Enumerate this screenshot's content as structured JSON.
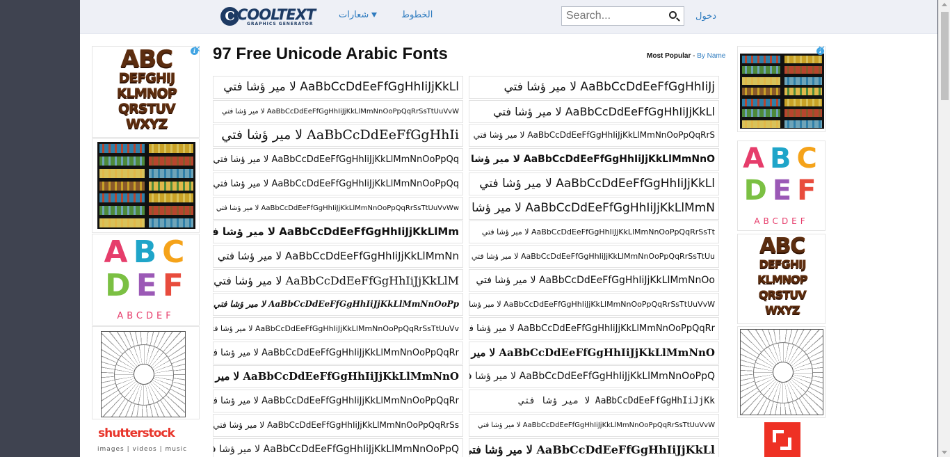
{
  "site": {
    "logo_text": "COOLTEXT",
    "logo_subtext": "GRAPHICS GENERATOR",
    "logo_mark": "C"
  },
  "nav": {
    "logos_label": "شعارات",
    "fonts_label": "الخطوط",
    "login_label": "دخول",
    "search_placeholder": "Search..."
  },
  "page": {
    "title": "97 Free Unicode Arabic Fonts",
    "sort_current": "Most Popular",
    "sort_separator": " - ",
    "sort_alt": "By Name"
  },
  "font_samples": [
    {
      "text": "لا مير ؤشا فتي AaBbCcDdEeFfGgHhIiJjKkLl",
      "size": 17,
      "family": "DejaVu Sans",
      "weight": "normal",
      "style": "normal"
    },
    {
      "text": "لا مير ؤشا فتي AaBbCcDdEeFfGgHhIiJj",
      "size": 17,
      "family": "DejaVu Sans",
      "weight": "normal",
      "style": "normal"
    },
    {
      "text": "لا مير ؤشا فتي AaBbCcDdEeFfGgHhIiJjKkLlMmNnOoPpQqRrSsTtUuVvW",
      "size": 10,
      "family": "DejaVu Sans",
      "weight": "normal",
      "style": "normal"
    },
    {
      "text": "لا مير ؤشا فتي AaBbCcDdEeFfGgHhIiJjKkLl",
      "size": 16,
      "family": "DejaVu Sans",
      "weight": "normal",
      "style": "normal"
    },
    {
      "text": "لا مير ؤشا فتي AaBbCcDdEeFfGgHhIi",
      "size": 19,
      "family": "DejaVu Serif",
      "weight": "normal",
      "style": "normal"
    },
    {
      "text": "لا مير ؤشا فتي AaBbCcDdEeFfGgHhIiJjKkLlMmNnOoPpQqRrS",
      "size": 12,
      "family": "DejaVu Sans",
      "weight": "normal",
      "style": "normal"
    },
    {
      "text": "لا مير ؤشا فتي AaBbCcDdEeFfGgHhIiJjKkLlMmNnOoPpQq",
      "size": 13,
      "family": "DejaVu Sans",
      "weight": "normal",
      "style": "normal"
    },
    {
      "text": "لا مير ؤشا فتي AaBbCcDdEeFfGgHhIiJjKkLlMmNnO",
      "size": 14,
      "family": "DejaVu Sans",
      "weight": "bold",
      "style": "normal"
    },
    {
      "text": "لا مير ؤشا فتي AaBbCcDdEeFfGgHhIiJjKkLlMmNnOoPpQq",
      "size": 13,
      "family": "DejaVu Sans",
      "weight": "normal",
      "style": "normal"
    },
    {
      "text": "لا مير ؤشا فتي AaBbCcDdEeFfGgHhIiJjKkLl",
      "size": 17,
      "family": "DejaVu Sans",
      "weight": "normal",
      "style": "normal"
    },
    {
      "text": "لا مير ؤشا فتي AaBbCcDdEeFfGgHhIiJjKkLlMmNnOoPpQqRrSsTtUuVvWw",
      "size": 10,
      "family": "DejaVu Sans",
      "weight": "normal",
      "style": "normal"
    },
    {
      "text": "لا مير ؤشا فتي AaBbCcDdEeFfGgHhIiJjKkLlMmN",
      "size": 17,
      "family": "DejaVu Sans",
      "weight": "normal",
      "style": "normal"
    },
    {
      "text": "لا مير ؤشا فتي AaBbCcDdEeFfGgHhIiJjKkLlMm",
      "size": 15,
      "family": "DejaVu Sans",
      "weight": "bold",
      "style": "normal"
    },
    {
      "text": "لا مير ؤشا فتي AaBbCcDdEeFfGgHhIiJjKkLlMmNnOoPpQqRrSsTt",
      "size": 11,
      "family": "DejaVu Sans",
      "weight": "normal",
      "style": "normal"
    },
    {
      "text": "لا مير ؤشا فتي AaBbCcDdEeFfGgHhIiJjKkLlMmNn",
      "size": 15,
      "family": "DejaVu Sans",
      "weight": "normal",
      "style": "normal"
    },
    {
      "text": "لا مير ؤشا فتي AaBbCcDdEeFfGgHhIiJjKkLlMmNnOoPpQqRrSsTtUu",
      "size": 11,
      "family": "DejaVu Sans",
      "weight": "normal",
      "style": "normal"
    },
    {
      "text": "لا مير ؤشا فتي AaBbCcDdEeFfGgHhIiJjKkLlM",
      "size": 16,
      "family": "DejaVu Serif",
      "weight": "normal",
      "style": "normal"
    },
    {
      "text": "لا مير ؤشا فتي AaBbCcDdEeFfGgHhIiJjKkLlMmNnOo",
      "size": 14,
      "family": "DejaVu Sans",
      "weight": "normal",
      "style": "normal"
    },
    {
      "text": "لا مير ؤشا فتي AaBbCcDdEeFfGgHhIiJjKkLlMmNnOoPp",
      "size": 12,
      "family": "DejaVu Serif",
      "weight": "bold",
      "style": "italic"
    },
    {
      "text": "لا مير ؤشا فتي AaBbCcDdEeFfGgHhIiJjKkLlMmNnOoPpQqRrSsTtUuVvW",
      "size": 11,
      "family": "DejaVu Sans",
      "weight": "normal",
      "style": "normal"
    },
    {
      "text": "لا مير ؤشا فتي AaBbCcDdEeFfGgHhIiJjKkLlMmNnOoPpQqRrSsTtUuVv",
      "size": 11,
      "family": "DejaVu Sans",
      "weight": "normal",
      "style": "normal"
    },
    {
      "text": "لا مير ؤشا فتي AaBbCcDdEeFfGgHhIiJjKkLlMmNnOoPpQqRr",
      "size": 13,
      "family": "DejaVu Sans",
      "weight": "normal",
      "style": "normal"
    },
    {
      "text": "لا مير ؤشا فتي AaBbCcDdEeFfGgHhIiJjKkLlMmNnOoPpQqRr",
      "size": 13,
      "family": "DejaVu Sans",
      "weight": "normal",
      "style": "normal"
    },
    {
      "text": "لا مير ؤشا فتي AaBbCcDdEeFfGgHhIiJjKkLlMmNnO",
      "size": 15,
      "family": "DejaVu Serif",
      "weight": "bold",
      "style": "normal"
    },
    {
      "text": "لا مير ؤشا فتي AaBbCcDdEeFfGgHhIiJjKkLlMmNnO",
      "size": 15,
      "family": "DejaVu Serif",
      "weight": "bold",
      "style": "normal"
    },
    {
      "text": "لا مير ؤشا فتي AaBbCcDdEeFfGgHhIiJjKkLlMmNnOoPpQ",
      "size": 14,
      "family": "DejaVu Sans",
      "weight": "normal",
      "style": "normal"
    },
    {
      "text": "لا مير ؤشا فتي AaBbCcDdEeFfGgHhIiJjKkLlMmNnOoPpQqRr",
      "size": 13,
      "family": "DejaVu Sans",
      "weight": "normal",
      "style": "normal"
    },
    {
      "text": "لا مير ؤشا فتي AaBbCcDdEeFfGgHhIiJjKk",
      "size": 13,
      "family": "DejaVu Sans Mono",
      "weight": "normal",
      "style": "normal"
    },
    {
      "text": "لا مير ؤشا فتي AaBbCcDdEeFfGgHhIiJjKkLlMmNnOoPpQqRrSs",
      "size": 12,
      "family": "DejaVu Sans",
      "weight": "normal",
      "style": "normal"
    },
    {
      "text": "لا مير ؤشا فتي AaBbCcDdEeFfGgHhIiJjKkLlMmNnOoPpQqRrSsTtUuVvW",
      "size": 10,
      "family": "DejaVu Sans",
      "weight": "normal",
      "style": "normal"
    },
    {
      "text": "لا مير ؤشا فتي AaBbCcDdEeFfGgHhIiJjKkLlMmNnOoPpQ",
      "size": 14,
      "family": "DejaVu Sans",
      "weight": "normal",
      "style": "normal"
    },
    {
      "text": "لا مير ؤشا فتي AaBbCcDdEeFfGgHhIiJjKkLl",
      "size": 16,
      "family": "DejaVu Serif",
      "weight": "bold",
      "style": "normal"
    }
  ],
  "ads": {
    "choc_text": "ABC DEFGHIJ KLMNOP QRSTUV WXYZ",
    "splash_big": "ABC DEF",
    "splash_small": "ABCDEF",
    "splash_colors": [
      "#e63d6b",
      "#1fa5c9",
      "#f5a31a",
      "#7bc043",
      "#9b59b6",
      "#e84c3d"
    ],
    "shutterstock_brand": "shutterstock",
    "shutterstock_tagline": "images | videos | music",
    "adchoice_icon": "info-icon",
    "close_icon": "x-icon"
  }
}
